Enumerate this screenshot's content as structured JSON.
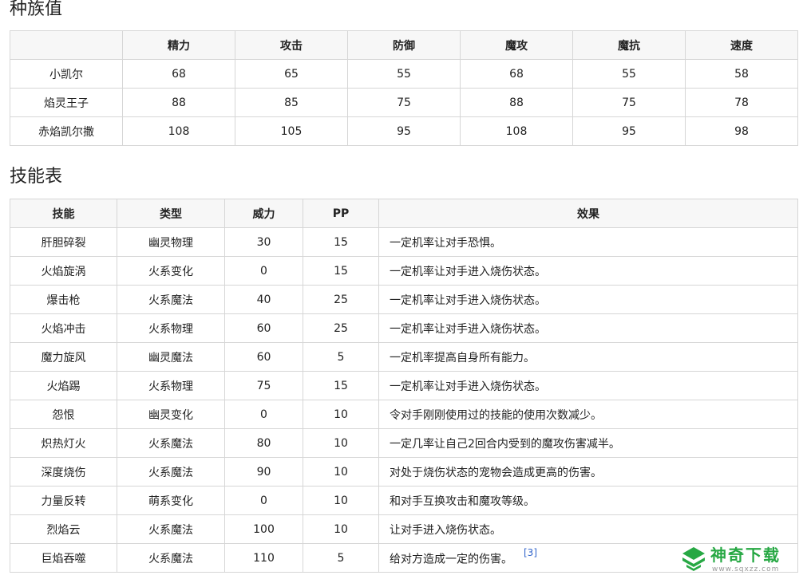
{
  "stats": {
    "title": "种族值",
    "headers": [
      "",
      "精力",
      "攻击",
      "防御",
      "魔攻",
      "魔抗",
      "速度"
    ],
    "rows": [
      [
        "小凯尔",
        "68",
        "65",
        "55",
        "68",
        "55",
        "58"
      ],
      [
        "焰灵王子",
        "88",
        "85",
        "75",
        "88",
        "75",
        "78"
      ],
      [
        "赤焰凯尔撒",
        "108",
        "105",
        "95",
        "108",
        "95",
        "98"
      ]
    ]
  },
  "skills": {
    "title": "技能表",
    "headers": [
      "技能",
      "类型",
      "威力",
      "PP",
      "效果"
    ],
    "rows": [
      [
        "肝胆碎裂",
        "幽灵物理",
        "30",
        "15",
        "一定机率让对手恐惧。"
      ],
      [
        "火焰旋涡",
        "火系变化",
        "0",
        "15",
        "一定机率让对手进入烧伤状态。"
      ],
      [
        "爆击枪",
        "火系魔法",
        "40",
        "25",
        "一定机率让对手进入烧伤状态。"
      ],
      [
        "火焰冲击",
        "火系物理",
        "60",
        "25",
        "一定机率让对手进入烧伤状态。"
      ],
      [
        "魔力旋风",
        "幽灵魔法",
        "60",
        "5",
        "一定机率提高自身所有能力。"
      ],
      [
        "火焰踢",
        "火系物理",
        "75",
        "15",
        "一定机率让对手进入烧伤状态。"
      ],
      [
        "怨恨",
        "幽灵变化",
        "0",
        "10",
        "令对手刚刚使用过的技能的使用次数减少。"
      ],
      [
        "炽热灯火",
        "火系魔法",
        "80",
        "10",
        "一定几率让自己2回合内受到的魔攻伤害减半。"
      ],
      [
        "深度烧伤",
        "火系魔法",
        "90",
        "10",
        "对处于烧伤状态的宠物会造成更高的伤害。"
      ],
      [
        "力量反转",
        "萌系变化",
        "0",
        "10",
        "和对手互换攻击和魔攻等级。"
      ],
      [
        "烈焰云",
        "火系魔法",
        "100",
        "10",
        "让对手进入烧伤状态。"
      ],
      [
        "巨焰吞噬",
        "火系魔法",
        "110",
        "5",
        "给对方造成一定的伤害。"
      ]
    ],
    "reference": "[3]"
  },
  "watermark": {
    "name": "神奇下载",
    "url": "www.sqxzz.com",
    "color": "#27a844",
    "icon": "leaf-logo-icon"
  }
}
